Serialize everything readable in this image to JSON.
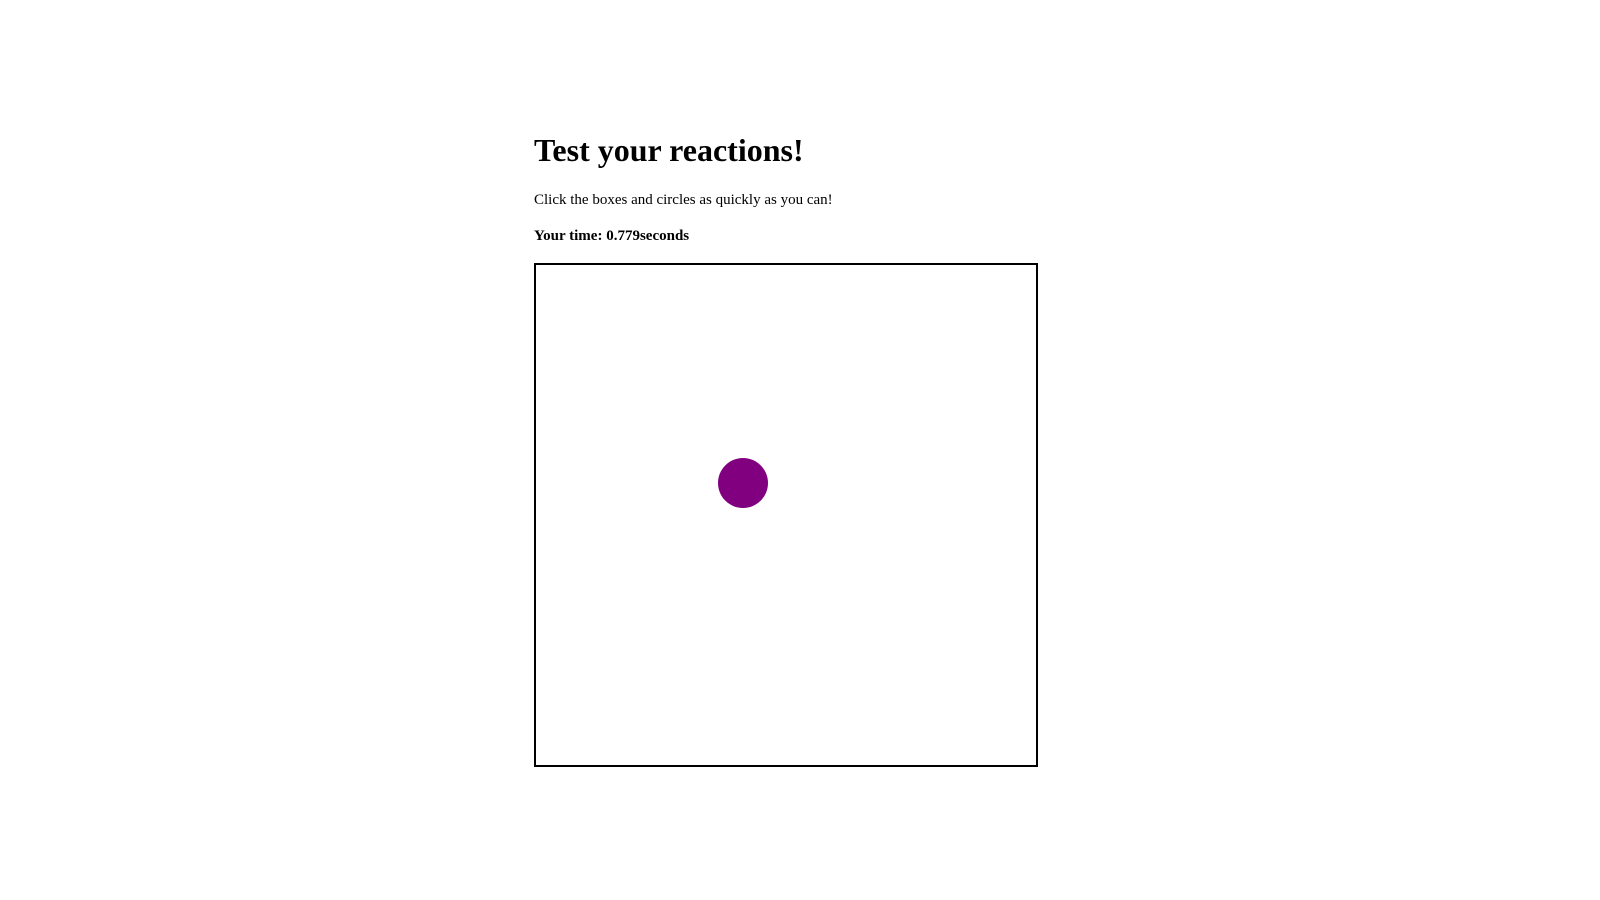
{
  "page": {
    "title": "Test your reactions!",
    "instructions": "Click the boxes and circles as quickly as you can!"
  },
  "result": {
    "label": "Your time:",
    "time_value": "0.779",
    "unit": "seconds"
  },
  "game": {
    "target": {
      "shape": "circle",
      "color": "#800080"
    },
    "border_color": "#000000"
  }
}
